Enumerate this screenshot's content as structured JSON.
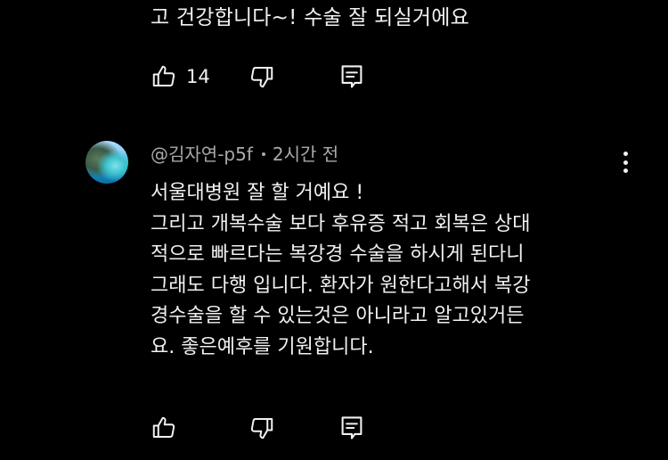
{
  "previous_comment": {
    "text_tail": "고  건강합니다~!  수술 잘 되실거에요",
    "like_count": "14"
  },
  "comment": {
    "author": "@김자연-p5f",
    "time": "2시간 전",
    "lines": [
      "서울대병원 잘 할 거예요 !",
      "그리고 개복수술 보다 후유증 적고 회복은 상대",
      "적으로 빠르다는 복강경 수술을 하시게 된다니",
      "그래도 다행 입니다. 환자가 원한다고해서 복강",
      "경수술을 할 수 있는것은 아니라고 알고있거든",
      "요. 좋은예후를 기원합니다."
    ]
  },
  "icons": {
    "like": "thumbs-up-icon",
    "dislike": "thumbs-down-icon",
    "reply": "reply-comment-icon",
    "menu": "more-vertical-icon"
  }
}
